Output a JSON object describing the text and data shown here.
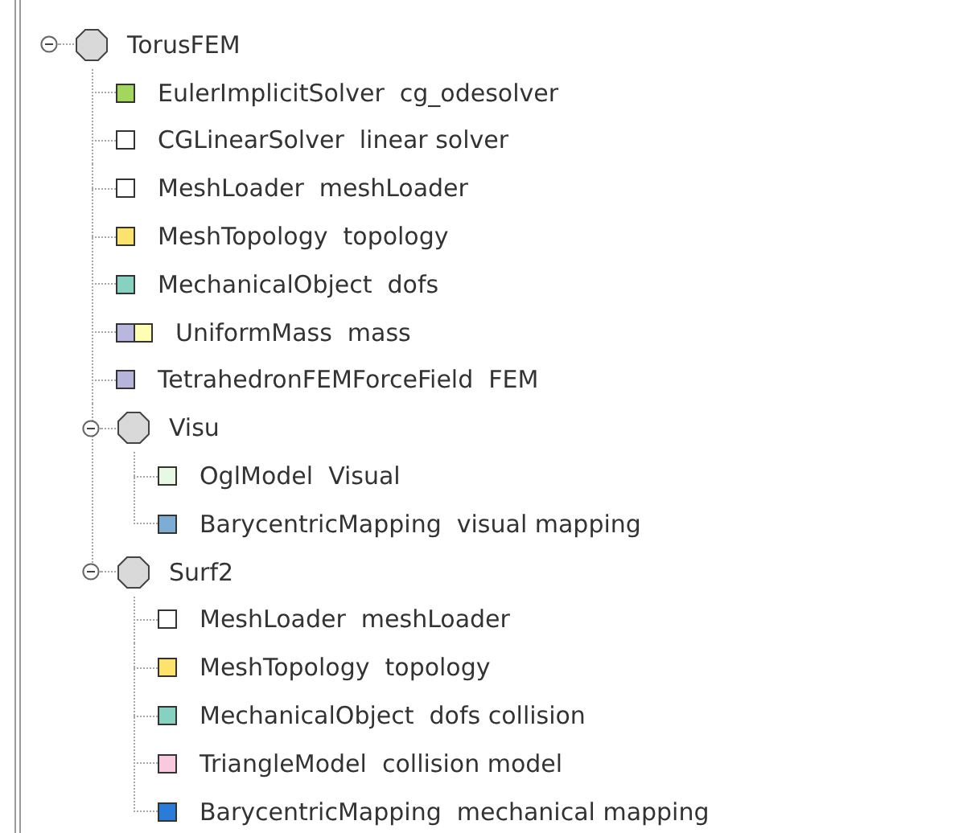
{
  "tree": {
    "name": "TorusFEM",
    "expanded": true,
    "children": [
      {
        "kind": "component",
        "label": "EulerImplicitSolver  cg_odesolver",
        "swatches": [
          {
            "color": "#a3d65c"
          }
        ]
      },
      {
        "kind": "component",
        "label": "CGLinearSolver  linear solver",
        "swatches": [
          {
            "color": "#ffffff"
          }
        ]
      },
      {
        "kind": "component",
        "label": "MeshLoader  meshLoader",
        "swatches": [
          {
            "color": "#ffffff"
          }
        ]
      },
      {
        "kind": "component",
        "label": "MeshTopology  topology",
        "swatches": [
          {
            "color": "#fbe36d"
          }
        ]
      },
      {
        "kind": "component",
        "label": "MechanicalObject  dofs",
        "swatches": [
          {
            "color": "#86d1c0"
          }
        ]
      },
      {
        "kind": "component",
        "label": "UniformMass  mass",
        "swatches": [
          {
            "color": "#b9b7dd"
          },
          {
            "color": "#ffffb3"
          }
        ]
      },
      {
        "kind": "component",
        "label": "TetrahedronFEMForceField  FEM",
        "swatches": [
          {
            "color": "#b6b4da"
          }
        ]
      },
      {
        "kind": "node",
        "name": "Visu",
        "expanded": true,
        "children": [
          {
            "kind": "component",
            "label": "OglModel  Visual",
            "swatches": [
              {
                "color": "#e8f8e2"
              }
            ]
          },
          {
            "kind": "component",
            "label": "BarycentricMapping  visual mapping",
            "swatches": [
              {
                "color": "#7eadd4"
              }
            ]
          }
        ]
      },
      {
        "kind": "node",
        "name": "Surf2",
        "expanded": true,
        "children": [
          {
            "kind": "component",
            "label": "MeshLoader  meshLoader",
            "swatches": [
              {
                "color": "#ffffff"
              }
            ]
          },
          {
            "kind": "component",
            "label": "MeshTopology  topology",
            "swatches": [
              {
                "color": "#fbe36d"
              }
            ]
          },
          {
            "kind": "component",
            "label": "MechanicalObject  dofs collision",
            "swatches": [
              {
                "color": "#86d1c0"
              }
            ]
          },
          {
            "kind": "component",
            "label": "TriangleModel  collision model",
            "swatches": [
              {
                "color": "#f9c9df"
              }
            ]
          },
          {
            "kind": "component",
            "label": "BarycentricMapping  mechanical mapping",
            "swatches": [
              {
                "color": "#2b7bd8"
              }
            ]
          }
        ]
      }
    ]
  }
}
